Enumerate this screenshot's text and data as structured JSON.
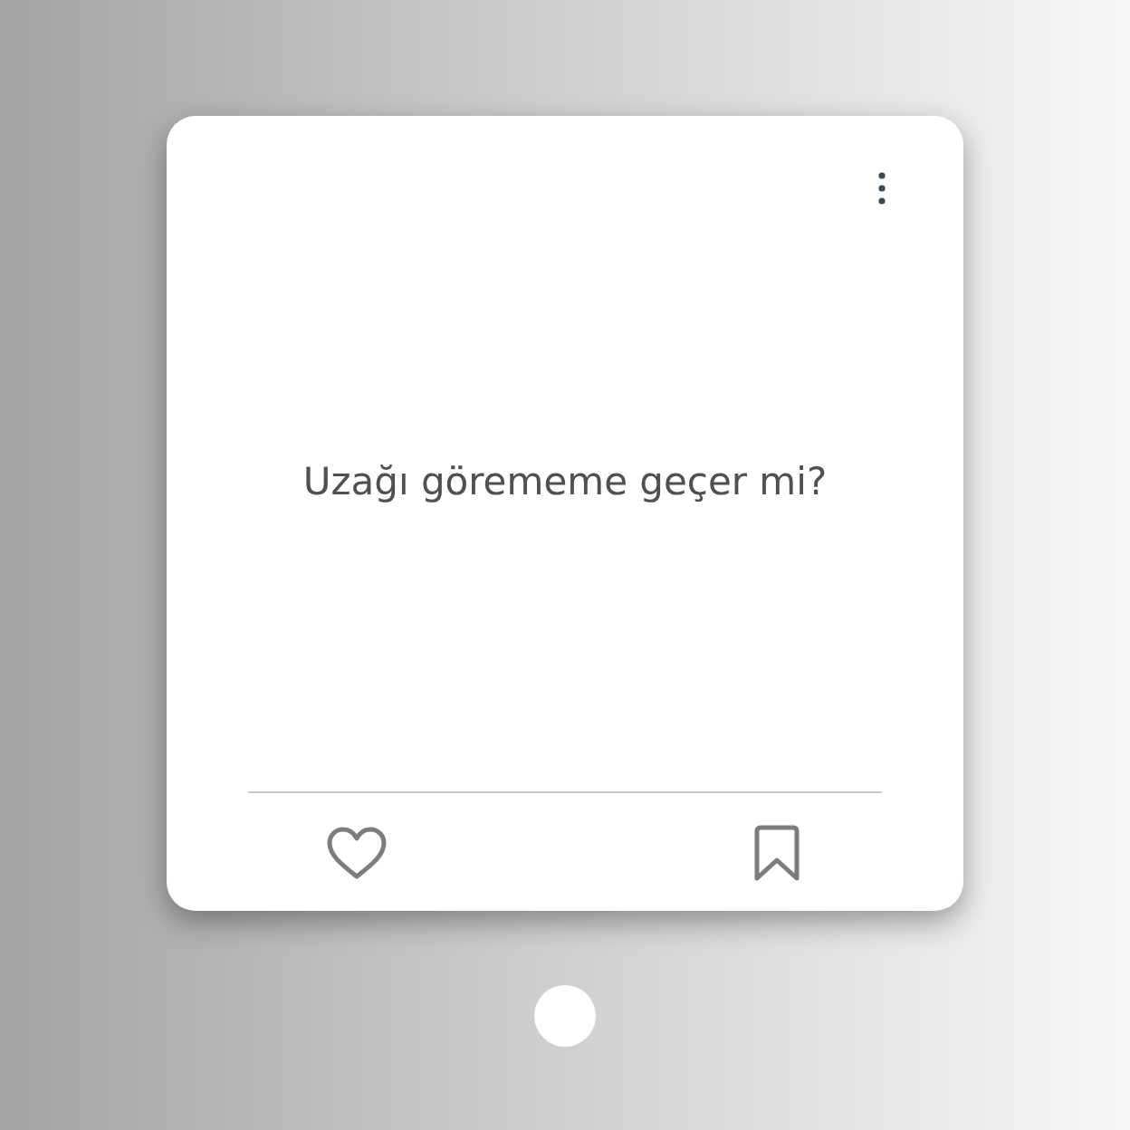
{
  "post": {
    "text": "Uzağı görememe geçer mi?"
  }
}
